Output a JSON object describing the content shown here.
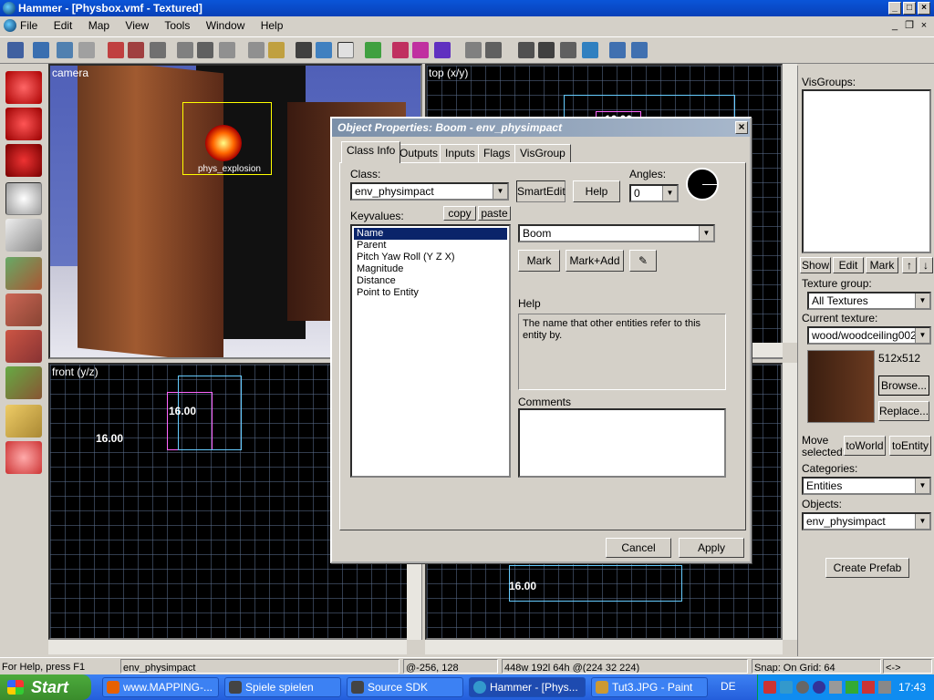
{
  "window": {
    "title": "Hammer - [Physbox.vmf - Textured]"
  },
  "menu": [
    "File",
    "Edit",
    "Map",
    "View",
    "Tools",
    "Window",
    "Help"
  ],
  "views": {
    "camera": {
      "label": "camera",
      "entity_label": "phys_explosion"
    },
    "top": {
      "label": "top (x/y)",
      "number": "16.00"
    },
    "front": {
      "label": "front (y/z)",
      "num1": "16.00",
      "num2": "16.00"
    },
    "side": {
      "number": "16.00"
    }
  },
  "dialog": {
    "title": "Object Properties: Boom - env_physimpact",
    "tabs": [
      "Class Info",
      "Outputs",
      "Inputs",
      "Flags",
      "VisGroup"
    ],
    "class_label": "Class:",
    "class_value": "env_physimpact",
    "smartedit": "SmartEdit",
    "help_btn": "Help",
    "angles_label": "Angles:",
    "angles_value": "0",
    "keyvalues_label": "Keyvalues:",
    "copy": "copy",
    "paste": "paste",
    "keyvalues": [
      "Name",
      "Parent",
      "Pitch Yaw Roll (Y Z X)",
      "Magnitude",
      "Distance",
      "Point to Entity"
    ],
    "name_value": "Boom",
    "mark": "Mark",
    "mark_add": "Mark+Add",
    "help_label": "Help",
    "help_text": "The name that other entities refer to this entity by.",
    "comments_label": "Comments",
    "cancel": "Cancel",
    "apply": "Apply"
  },
  "right_panel": {
    "visgroups_label": "VisGroups:",
    "show": "Show",
    "edit": "Edit",
    "mark": "Mark",
    "texture_group_label": "Texture group:",
    "texture_group_value": "All Textures",
    "current_texture_label": "Current texture:",
    "current_texture_value": "wood/woodceiling002a",
    "texture_size": "512x512",
    "browse": "Browse...",
    "replace": "Replace...",
    "move_selected_label1": "Move",
    "move_selected_label2": "selected:",
    "to_world": "toWorld",
    "to_entity": "toEntity",
    "categories_label": "Categories:",
    "categories_value": "Entities",
    "objects_label": "Objects:",
    "objects_value": "env_physimpact",
    "create_prefab": "Create Prefab"
  },
  "status": {
    "help": "For Help, press F1",
    "entity": "env_physimpact",
    "coords": "@-256, 128",
    "size": "448w 192l 64h @(224 32 224)",
    "snap": "Snap: On Grid: 64",
    "arrows": "<->"
  },
  "taskbar": {
    "start": "Start",
    "tasks": [
      "www.MAPPING-...",
      "Spiele spielen",
      "Source SDK",
      "Hammer - [Phys...",
      "Tut3.JPG - Paint"
    ],
    "lang": "DE",
    "clock": "17:43"
  }
}
